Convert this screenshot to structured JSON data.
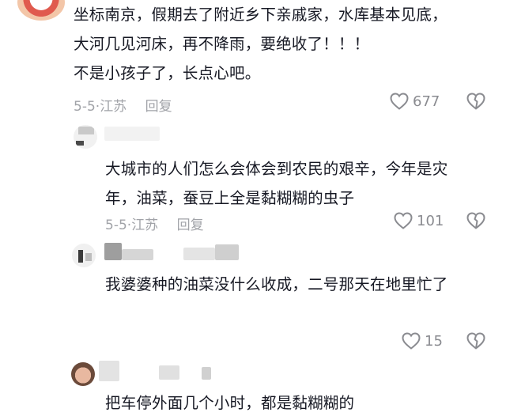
{
  "comments": [
    {
      "text_lines": [
        "坐标南京，假期去了附近乡下亲戚家，水库基本见底，",
        "大河几见河床，再不降雨，要绝收了！！！",
        "不是小孩子了，长点心吧。"
      ],
      "date": "5-5",
      "region": "江苏",
      "reply_label": "回复",
      "likes": "677"
    },
    {
      "text_lines": [
        "大城市的人们怎么会体会到农民的艰辛，今年是灾",
        "年，油菜，蚕豆上全是黏糊糊的虫子"
      ],
      "date": "5-5",
      "region": "江苏",
      "reply_label": "回复",
      "likes": "101"
    },
    {
      "text_lines": [
        "我婆婆种的油菜没什么收成，二号那天在地里忙了"
      ],
      "likes": "15"
    },
    {
      "text_lines": [
        "把车停外面几个小时，都是黏糊糊的"
      ]
    }
  ],
  "icons": {
    "like": "heart-outline-icon",
    "dislike": "broken-heart-icon"
  },
  "colors": {
    "text": "#161823",
    "meta": "#a1a3a8"
  }
}
